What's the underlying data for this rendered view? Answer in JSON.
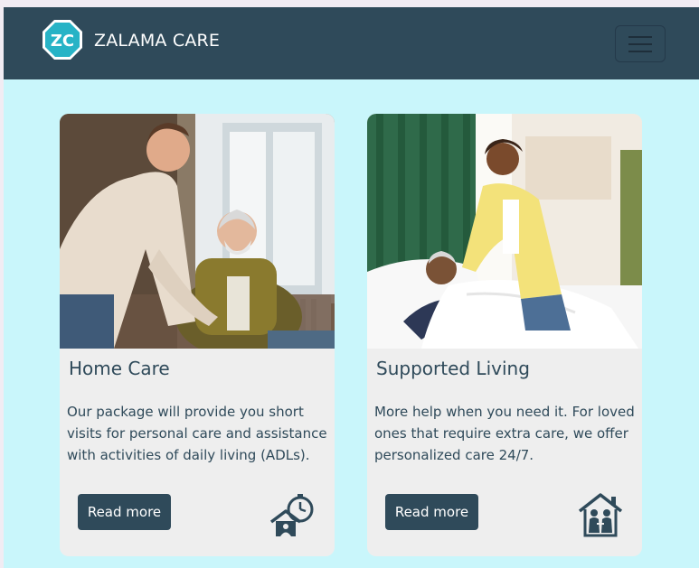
{
  "header": {
    "logo_text": "ZC",
    "brand": "ZALAMA CARE",
    "menu_icon": "hamburger-menu-icon"
  },
  "colors": {
    "navbar": "#2f4a5a",
    "page_background": "#c9f6fb",
    "card_background": "#eeeeee",
    "logo_teal": "#27b3c6"
  },
  "cards": [
    {
      "title": "Home Care",
      "body": "Our package will provide you short visits for personal care and assistance with activities of daily living (ADLs).",
      "button": "Read more",
      "icon": "home-timer-icon",
      "image": "caregiver-giving-medicine-to-elderly-man-photo"
    },
    {
      "title": "Supported Living",
      "body": "More help when you need it. For loved ones that require extra care, we offer personalized care 24/7.",
      "button": "Read more",
      "icon": "house-with-people-icon",
      "image": "caregiver-tucking-in-elderly-man-photo"
    }
  ]
}
